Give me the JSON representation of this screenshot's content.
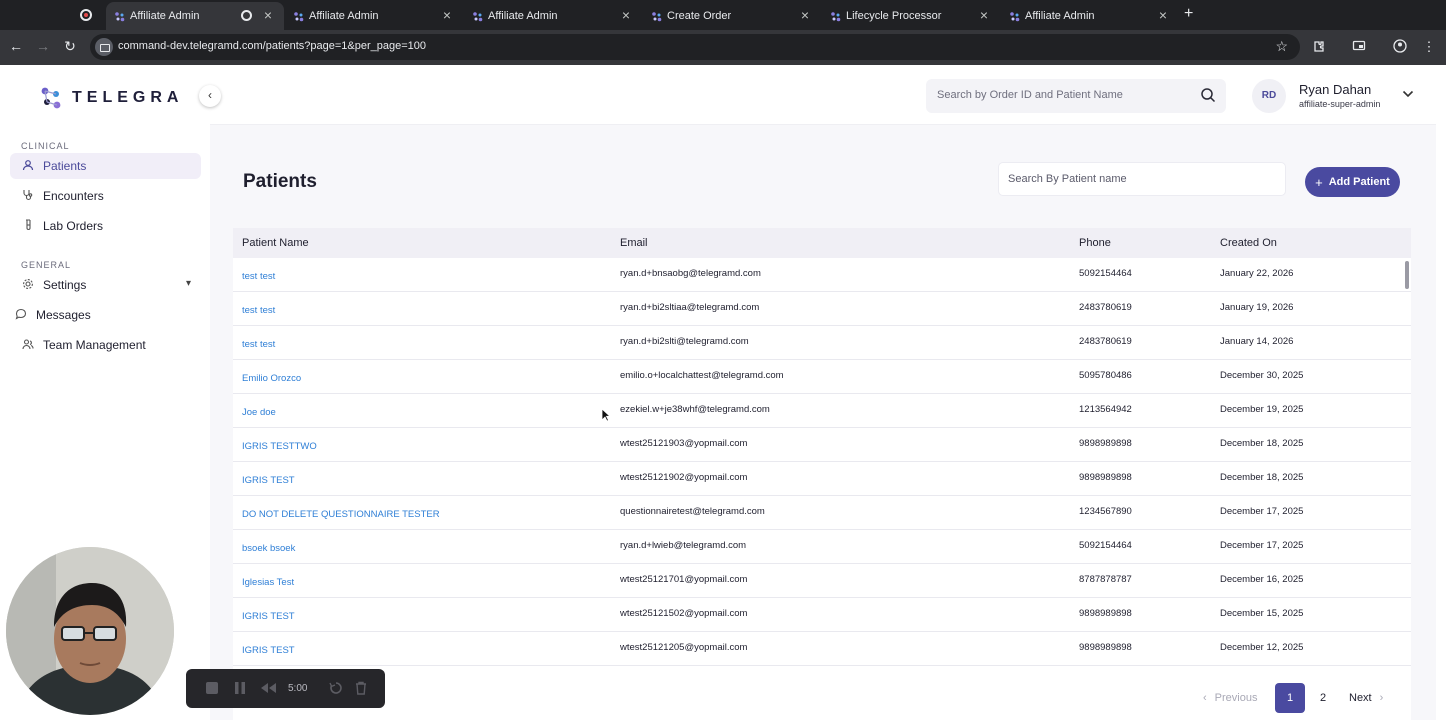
{
  "browser": {
    "tabs": [
      {
        "title": "Affiliate Admin",
        "active": true
      },
      {
        "title": "Affiliate Admin",
        "active": false
      },
      {
        "title": "Affiliate Admin",
        "active": false
      },
      {
        "title": "Create Order",
        "active": false
      },
      {
        "title": "Lifecycle Processor",
        "active": false
      },
      {
        "title": "Affiliate Admin",
        "active": false
      }
    ],
    "url": "command-dev.telegramd.com/patients?page=1&per_page=100"
  },
  "sidebar": {
    "brand": "TELEGRA",
    "sections": [
      {
        "label": "CLINICAL",
        "items": [
          {
            "label": "Patients",
            "icon": "user-icon",
            "active": true
          },
          {
            "label": "Encounters",
            "icon": "stethoscope-icon",
            "active": false
          },
          {
            "label": "Lab Orders",
            "icon": "test-tube-icon",
            "active": false
          }
        ]
      },
      {
        "label": "GENERAL",
        "items": [
          {
            "label": "Settings",
            "icon": "gear-icon",
            "active": false,
            "expandable": true
          },
          {
            "label": "Messages",
            "icon": "chat-bubble-icon",
            "active": false
          },
          {
            "label": "Team Management",
            "icon": "team-icon",
            "active": false
          }
        ]
      }
    ]
  },
  "header": {
    "search_placeholder": "Search by Order ID and Patient Name",
    "user": {
      "initials": "RD",
      "name": "Ryan Dahan",
      "role": "affiliate-super-admin"
    }
  },
  "main": {
    "title": "Patients",
    "search_placeholder": "Search By Patient name",
    "add_button": "Add Patient",
    "table": {
      "columns": [
        "Patient Name",
        "Email",
        "Phone",
        "Created On"
      ],
      "rows": [
        {
          "name": "test test",
          "email": "ryan.d+bnsaobg@telegramd.com",
          "phone": "5092154464",
          "created": "January 22, 2026"
        },
        {
          "name": "test test",
          "email": "ryan.d+bi2sltiaa@telegramd.com",
          "phone": "2483780619",
          "created": "January 19, 2026"
        },
        {
          "name": "test test",
          "email": "ryan.d+bi2slti@telegramd.com",
          "phone": "2483780619",
          "created": "January 14, 2026"
        },
        {
          "name": "Emilio Orozco",
          "email": "emilio.o+localchattest@telegramd.com",
          "phone": "5095780486",
          "created": "December 30, 2025"
        },
        {
          "name": "Joe doe",
          "email": "ezekiel.w+je38whf@telegramd.com",
          "phone": "1213564942",
          "created": "December 19, 2025"
        },
        {
          "name": "IGRIS TESTTWO",
          "email": "wtest25121903@yopmail.com",
          "phone": "9898989898",
          "created": "December 18, 2025"
        },
        {
          "name": "IGRIS TEST",
          "email": "wtest25121902@yopmail.com",
          "phone": "9898989898",
          "created": "December 18, 2025"
        },
        {
          "name": "DO NOT DELETE QUESTIONNAIRE TESTER",
          "email": "questionnairetest@telegramd.com",
          "phone": "1234567890",
          "created": "December 17, 2025"
        },
        {
          "name": "bsoek bsoek",
          "email": "ryan.d+lwieb@telegramd.com",
          "phone": "5092154464",
          "created": "December 17, 2025"
        },
        {
          "name": "Iglesias Test",
          "email": "wtest25121701@yopmail.com",
          "phone": "8787878787",
          "created": "December 16, 2025"
        },
        {
          "name": "IGRIS TEST",
          "email": "wtest25121502@yopmail.com",
          "phone": "9898989898",
          "created": "December 15, 2025"
        },
        {
          "name": "IGRIS TEST",
          "email": "wtest25121205@yopmail.com",
          "phone": "9898989898",
          "created": "December 12, 2025"
        }
      ]
    },
    "pagination": {
      "previous": "Previous",
      "pages": [
        "1",
        "2"
      ],
      "current": "1",
      "next": "Next"
    }
  },
  "recorder": {
    "timer": "5:00"
  },
  "colors": {
    "accent": "#4a4aa0",
    "link": "#2f7fd6",
    "active_nav_bg": "#f1eef8"
  }
}
